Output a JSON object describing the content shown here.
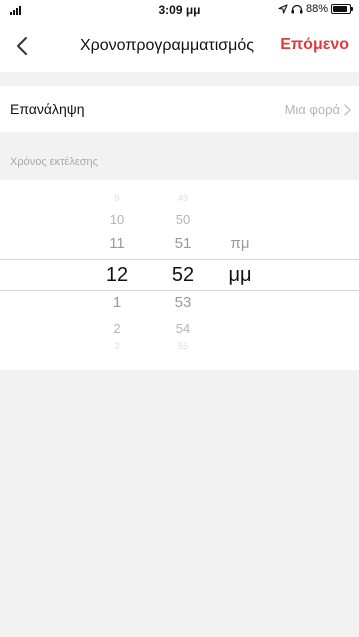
{
  "status_bar": {
    "time": "3:09 μμ",
    "battery": "88%",
    "battery_level": 0.88
  },
  "nav": {
    "title": "Χρονοπρογραμματισμός",
    "next_label": "Επόμενο",
    "accent": "#e03a3a"
  },
  "repeat": {
    "label": "Επανάληψη",
    "value": "Μια φορά"
  },
  "section": {
    "label": "Χρόνος εκτέλεσης"
  },
  "picker": {
    "hours": [
      "9",
      "10",
      "11",
      "12",
      "1",
      "2",
      "3"
    ],
    "minutes": [
      "49",
      "50",
      "51",
      "52",
      "53",
      "54",
      "55"
    ],
    "ampm": [
      "πμ",
      "μμ"
    ],
    "selected": {
      "hour": "12",
      "minute": "52",
      "ampm": "μμ"
    }
  }
}
